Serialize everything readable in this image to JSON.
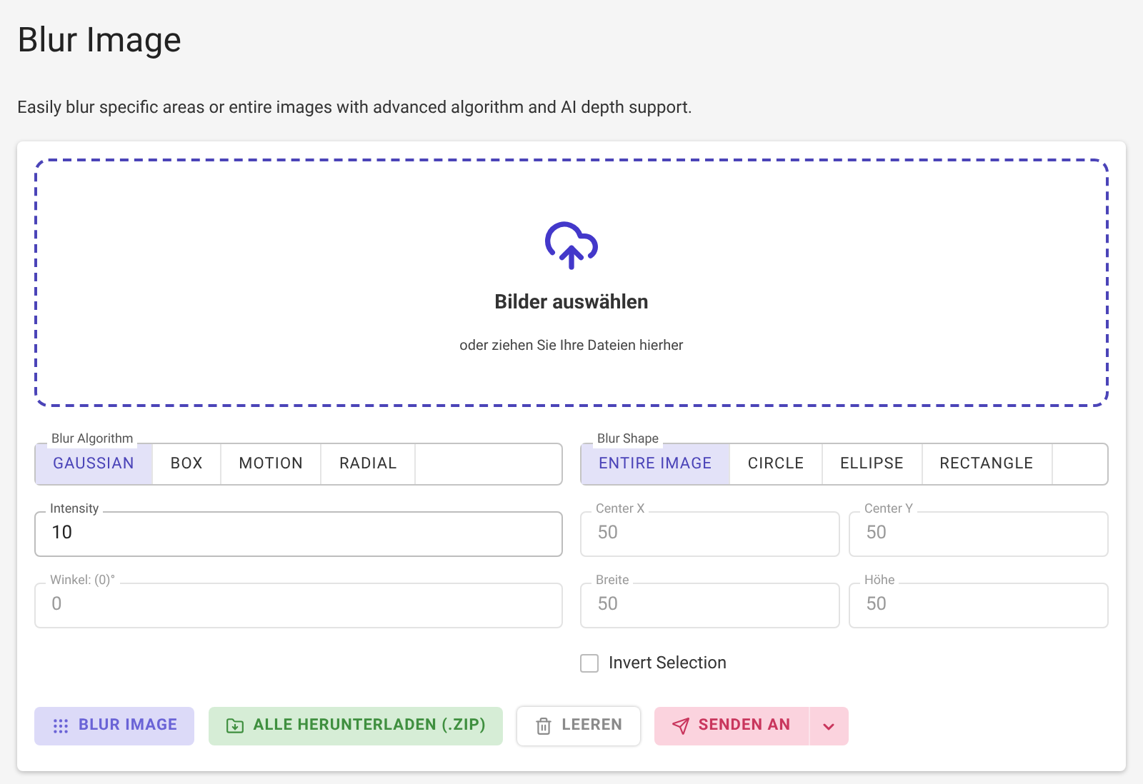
{
  "title": "Blur Image",
  "description": "Easily blur specific areas or entire images with advanced algorithm and AI depth support.",
  "dropzone": {
    "heading": "Bilder auswählen",
    "hint": "oder ziehen Sie Ihre Dateien hierher"
  },
  "algorithm": {
    "label": "Blur Algorithm",
    "options": [
      {
        "label": "GAUSSIAN",
        "selected": true
      },
      {
        "label": "BOX",
        "selected": false
      },
      {
        "label": "MOTION",
        "selected": false
      },
      {
        "label": "RADIAL",
        "selected": false
      }
    ]
  },
  "shape": {
    "label": "Blur Shape",
    "options": [
      {
        "label": "ENTIRE IMAGE",
        "selected": true
      },
      {
        "label": "CIRCLE",
        "selected": false
      },
      {
        "label": "ELLIPSE",
        "selected": false
      },
      {
        "label": "RECTANGLE",
        "selected": false
      }
    ]
  },
  "intensity": {
    "label": "Intensity",
    "value": "10",
    "disabled": false
  },
  "angle": {
    "label": "Winkel: (0)°",
    "value": "0",
    "disabled": true
  },
  "center_x": {
    "label": "Center X",
    "value": "50",
    "disabled": true
  },
  "center_y": {
    "label": "Center Y",
    "value": "50",
    "disabled": true
  },
  "width": {
    "label": "Breite",
    "value": "50",
    "disabled": true
  },
  "height": {
    "label": "Höhe",
    "value": "50",
    "disabled": true
  },
  "invert": {
    "label": "Invert Selection",
    "checked": false
  },
  "buttons": [
    {
      "kind": "blur",
      "label": "BLUR IMAGE",
      "disabled": true
    },
    {
      "kind": "download",
      "label": "ALLE HERUNTERLADEN (.ZIP)",
      "disabled": true
    },
    {
      "kind": "clear",
      "label": "LEEREN",
      "disabled": true
    },
    {
      "kind": "send",
      "label": "SENDEN AN",
      "disabled": true
    }
  ]
}
